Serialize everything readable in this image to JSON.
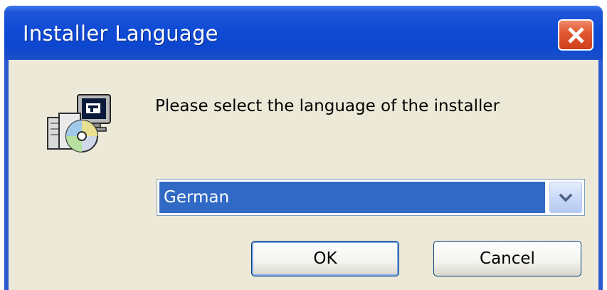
{
  "window": {
    "title": "Installer Language"
  },
  "dialog": {
    "prompt": "Please select the language of the installer",
    "language_select": {
      "selected": "German"
    },
    "buttons": {
      "ok_label": "OK",
      "cancel_label": "Cancel"
    }
  },
  "icons": {
    "app": "installer-setup-icon",
    "close": "close-icon",
    "dropdown": "chevron-down-icon"
  },
  "colors": {
    "titlebar": "#0d47cf",
    "close_button": "#e15a33",
    "dialog_background": "#ece9d8",
    "selection_highlight": "#316ac5"
  }
}
